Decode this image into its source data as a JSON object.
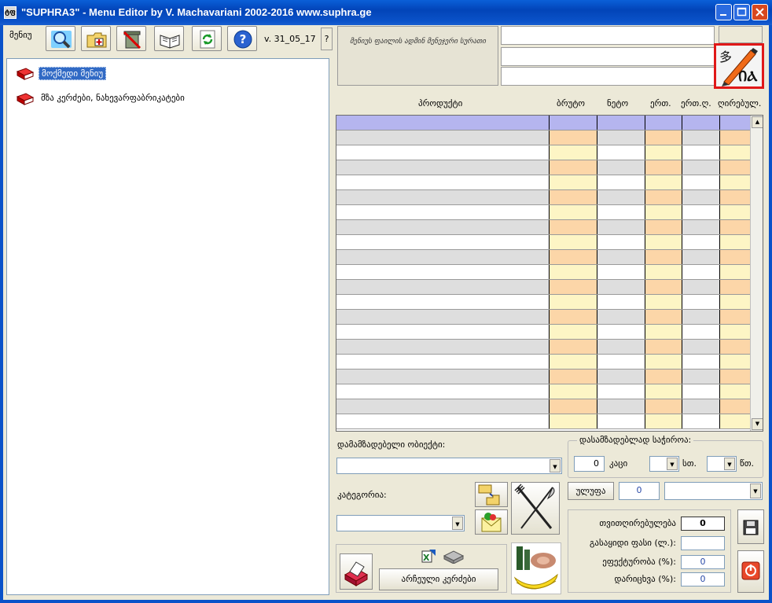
{
  "window": {
    "title": "\"SUPHRA3\" - Menu Editor by V. Machavariani  2002-2016  www.suphra.ge",
    "icon_text": "ტფ"
  },
  "toolbar": {
    "menu_label": "მენიუ",
    "version": "v. 31_05_17",
    "help_small": "?"
  },
  "tree": {
    "items": [
      {
        "label": "მოქმედი მენიუ",
        "selected": true
      },
      {
        "label": "მზა კერძები, ნახევარფაბრიკატები",
        "selected": false
      }
    ]
  },
  "header": {
    "menu_description": "მენიუს ფაილის ადმინ მენეჯერი სურათი"
  },
  "grid": {
    "columns": [
      "პროდუქტი",
      "ბრუტო",
      "ნეტო",
      "ერთ.",
      "ერთ.ღ.",
      "ღირებულ."
    ]
  },
  "bottom": {
    "object_label": "დამამზადებელი ობიექტი:",
    "prep_group_title": "დასამზადებლად საჭიროა:",
    "people_value": "0",
    "people_unit": "კაცი",
    "hour_unit": "სთ.",
    "minute_unit": "წთ.",
    "category_label": "კატეგორია:",
    "portion_button": "ულუფა",
    "portion_value": "0",
    "cost_label": "თვითღირებულება",
    "cost_value": "0",
    "sale_price_label": "გასაყიდი ფასი (ლ.):",
    "sale_price_value": "",
    "efficiency_label": "ეფექტურობა (%):",
    "efficiency_value": "0",
    "discount_label": "დარიცხვა (%):",
    "discount_value": "0",
    "selected_dishes_button": "არჩეული კერძები"
  },
  "colors": {
    "grid_header": "#b5b5ef",
    "row_gray": "#dedede",
    "row_white": "#ffffff",
    "cell_orange": "#fcd6a8",
    "cell_yellow": "#fdf5c5",
    "selection": "#316ac5",
    "highlight_border": "#e01818"
  }
}
